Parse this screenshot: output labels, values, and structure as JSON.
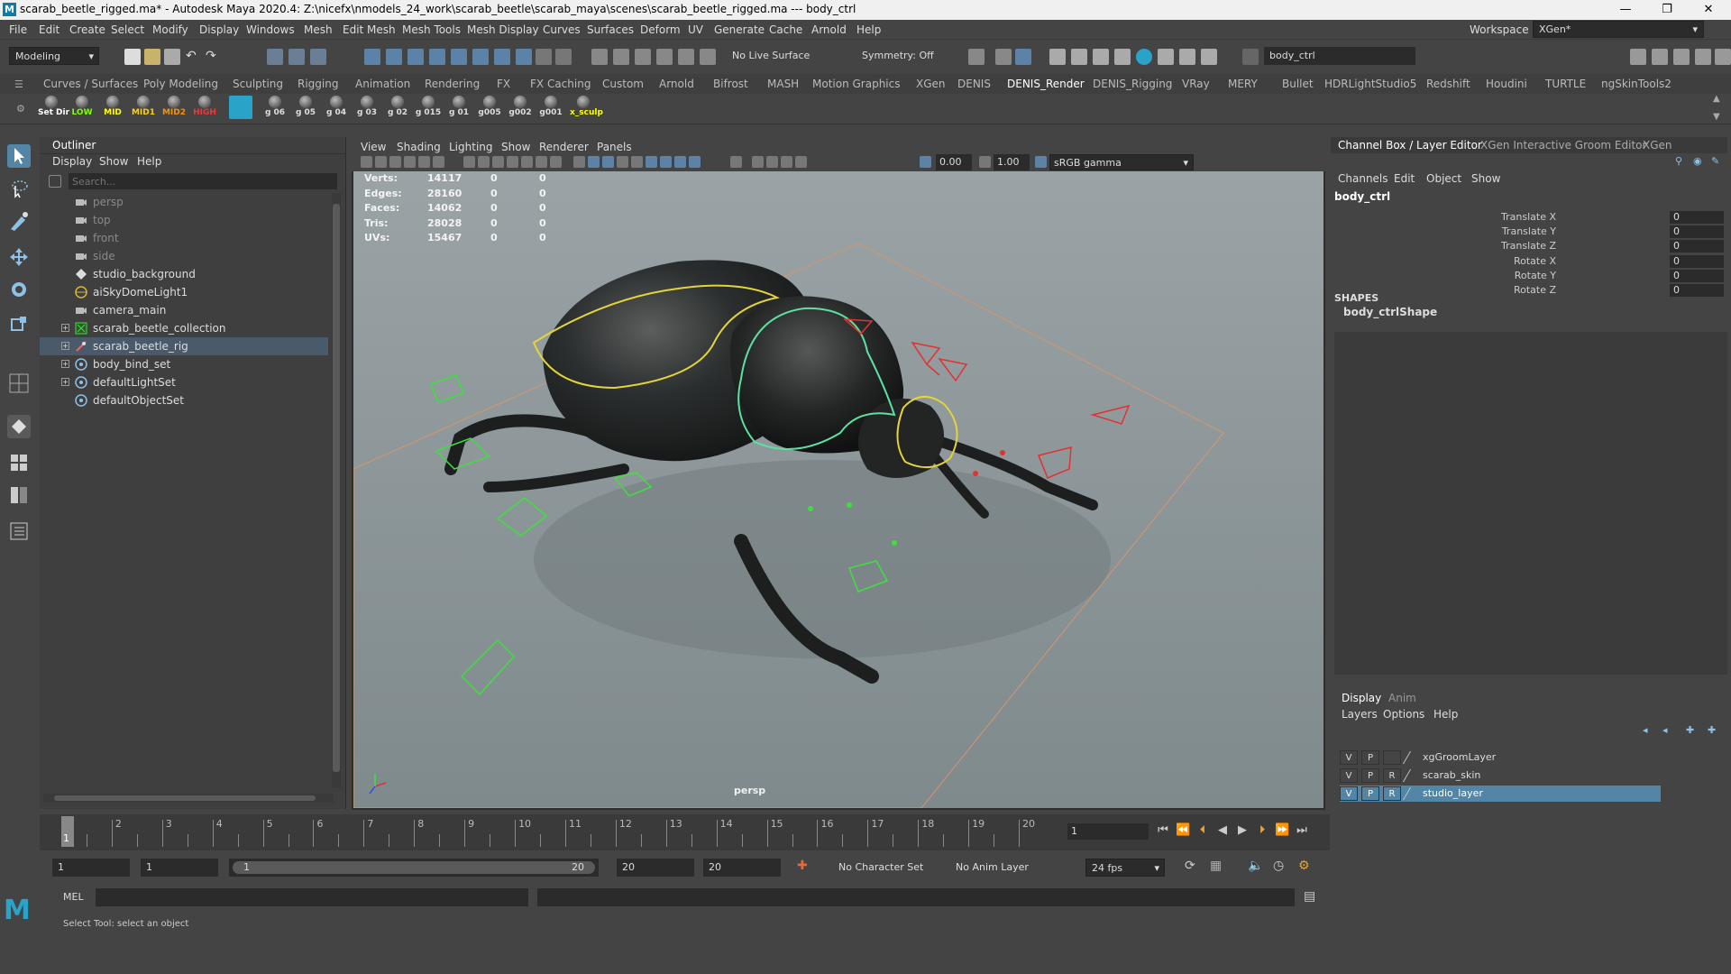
{
  "window": {
    "title": "scarab_beetle_rigged.ma* - Autodesk Maya 2020.4: Z:\\nicefx\\nmodels_24_work\\scarab_beetle\\scarab_maya\\scenes\\scarab_beetle_rigged.ma   ---   body_ctrl",
    "minimize": "—",
    "restore": "❐",
    "close": "✕"
  },
  "menu": [
    "File",
    "Edit",
    "Create",
    "Select",
    "Modify",
    "Display",
    "Windows",
    "Mesh",
    "Edit Mesh",
    "Mesh Tools",
    "Mesh Display",
    "Curves",
    "Surfaces",
    "Deform",
    "UV",
    "Generate",
    "Cache",
    "Arnold",
    "Help"
  ],
  "workspace": {
    "label": "Workspace :",
    "value": "XGen*"
  },
  "statusline": {
    "mode": "Modeling",
    "live_surface": "No Live Surface",
    "symmetry": "Symmetry: Off",
    "selection_field": "body_ctrl"
  },
  "shelf_tabs": [
    "Curves / Surfaces",
    "Poly Modeling",
    "Sculpting",
    "Rigging",
    "Animation",
    "Rendering",
    "FX",
    "FX Caching",
    "Custom",
    "Arnold",
    "Bifrost",
    "MASH",
    "Motion Graphics",
    "XGen",
    "DENIS",
    "DENIS_Render",
    "DENIS_Rigging",
    "VRay",
    "MERY",
    "Bullet",
    "HDRLightStudio5",
    "Redshift",
    "Houdini",
    "TURTLE",
    "ngSkinTools2"
  ],
  "shelf_active": "DENIS_Render",
  "shelf_buttons": [
    {
      "label": "Set Dir",
      "color": "#ffffff"
    },
    {
      "label": "LOW",
      "color": "#7fff00"
    },
    {
      "label": "MID",
      "color": "#ffff00"
    },
    {
      "label": "MID1",
      "color": "#ffd000"
    },
    {
      "label": "MID2",
      "color": "#ff9000"
    },
    {
      "label": "HIGH",
      "color": "#ff3030"
    },
    {
      "label": "",
      "color": "#ffffff"
    },
    {
      "label": "g 06",
      "color": "#dddddd"
    },
    {
      "label": "g 05",
      "color": "#dddddd"
    },
    {
      "label": "g 04",
      "color": "#dddddd"
    },
    {
      "label": "g 03",
      "color": "#dddddd"
    },
    {
      "label": "g 02",
      "color": "#dddddd"
    },
    {
      "label": "g 015",
      "color": "#dddddd"
    },
    {
      "label": "g 01",
      "color": "#dddddd"
    },
    {
      "label": "g005",
      "color": "#dddddd"
    },
    {
      "label": "g002",
      "color": "#dddddd"
    },
    {
      "label": "g001",
      "color": "#dddddd"
    },
    {
      "label": "x_sculp",
      "color": "#ffff00"
    }
  ],
  "outliner": {
    "title": "Outliner",
    "menu": [
      "Display",
      "Show",
      "Help"
    ],
    "search_placeholder": "Search...",
    "items": [
      {
        "label": "persp",
        "icon": "camera-icon",
        "dim": true,
        "expand": false
      },
      {
        "label": "top",
        "icon": "camera-icon",
        "dim": true,
        "expand": false
      },
      {
        "label": "front",
        "icon": "camera-icon",
        "dim": true,
        "expand": false
      },
      {
        "label": "side",
        "icon": "camera-icon",
        "dim": true,
        "expand": false
      },
      {
        "label": "studio_background",
        "icon": "mesh-icon",
        "dim": false,
        "expand": false
      },
      {
        "label": "aiSkyDomeLight1",
        "icon": "skydome-icon",
        "dim": false,
        "expand": false
      },
      {
        "label": "camera_main",
        "icon": "camera-icon",
        "dim": false,
        "expand": false
      },
      {
        "label": "scarab_beetle_collection",
        "icon": "group-icon",
        "dim": false,
        "expand": true
      },
      {
        "label": "scarab_beetle_rig",
        "icon": "rig-icon",
        "dim": false,
        "expand": true,
        "selected": true
      },
      {
        "label": "body_bind_set",
        "icon": "set-icon",
        "dim": false,
        "expand": true
      },
      {
        "label": "defaultLightSet",
        "icon": "set-icon",
        "dim": false,
        "expand": true
      },
      {
        "label": "defaultObjectSet",
        "icon": "set-icon",
        "dim": false,
        "expand": false
      }
    ]
  },
  "viewport": {
    "menu": [
      "View",
      "Shading",
      "Lighting",
      "Show",
      "Renderer",
      "Panels"
    ],
    "exposure": "0.00",
    "gamma": "1.00",
    "colorspace": "sRGB gamma",
    "camera_label": "persp",
    "hud": [
      {
        "label": "Verts:",
        "v1": "14117",
        "v2": "0",
        "v3": "0"
      },
      {
        "label": "Edges:",
        "v1": "28160",
        "v2": "0",
        "v3": "0"
      },
      {
        "label": "Faces:",
        "v1": "14062",
        "v2": "0",
        "v3": "0"
      },
      {
        "label": "Tris:",
        "v1": "28028",
        "v2": "0",
        "v3": "0"
      },
      {
        "label": "UVs:",
        "v1": "15467",
        "v2": "0",
        "v3": "0"
      }
    ]
  },
  "channelbox": {
    "tabs": [
      "Channel Box / Layer Editor",
      "XGen Interactive Groom Editor",
      "XGen"
    ],
    "menu": [
      "Channels",
      "Edit",
      "Object",
      "Show"
    ],
    "object": "body_ctrl",
    "attributes": [
      {
        "name": "Translate X",
        "value": "0"
      },
      {
        "name": "Translate Y",
        "value": "0"
      },
      {
        "name": "Translate Z",
        "value": "0"
      },
      {
        "name": "Rotate X",
        "value": "0"
      },
      {
        "name": "Rotate Y",
        "value": "0"
      },
      {
        "name": "Rotate Z",
        "value": "0"
      }
    ],
    "shapes_header": "SHAPES",
    "shape": "body_ctrlShape"
  },
  "layers": {
    "tabs": [
      "Display",
      "Anim"
    ],
    "menu": [
      "Layers",
      "Options",
      "Help"
    ],
    "items": [
      {
        "v": "V",
        "p": "P",
        "r": "",
        "name": "xgGroomLayer",
        "selected": false
      },
      {
        "v": "V",
        "p": "P",
        "r": "R",
        "name": "scarab_skin",
        "selected": false
      },
      {
        "v": "V",
        "p": "P",
        "r": "R",
        "name": "studio_layer",
        "selected": true
      }
    ]
  },
  "timeline": {
    "ticks": [
      "1",
      "2",
      "3",
      "4",
      "5",
      "6",
      "7",
      "8",
      "9",
      "10",
      "11",
      "12",
      "13",
      "14",
      "15",
      "16",
      "17",
      "18",
      "19",
      "20"
    ],
    "current_frame_marker": "1",
    "current_frame": "1",
    "range_start": "1",
    "range_start2": "1",
    "range_slider_start": "1",
    "range_slider_end": "20",
    "range_end": "20",
    "range_end2": "20",
    "character_set": "No Character Set",
    "anim_layer": "No Anim Layer",
    "fps": "24 fps"
  },
  "command": {
    "mel_label": "MEL"
  },
  "help_line": "Select Tool: select an object"
}
